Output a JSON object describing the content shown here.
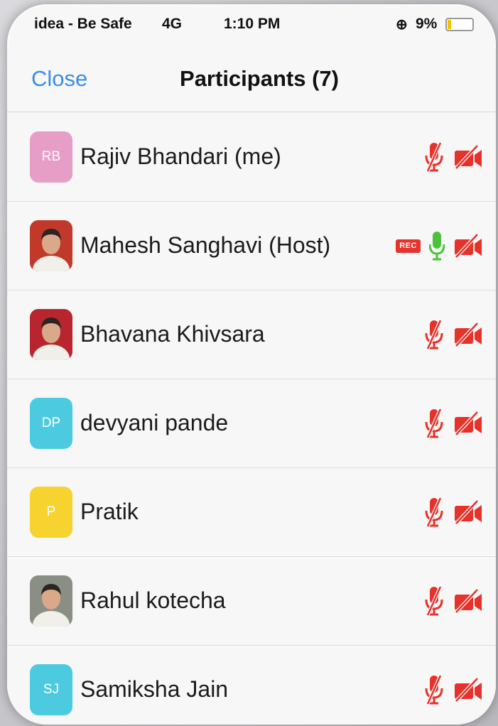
{
  "status_bar": {
    "carrier": "idea - Be Safe",
    "network": "4G",
    "time": "1:10 PM",
    "battery": "9%"
  },
  "header": {
    "close_label": "Close",
    "title": "Participants (7)"
  },
  "colors": {
    "accent": "#3a8ee6",
    "muted_red": "#e5322a",
    "mic_on_green": "#4cc23c"
  },
  "participants": [
    {
      "name": "Rajiv Bhandari (me)",
      "initials": "RB",
      "avatar_color": "#e69ec6",
      "avatar_type": "initials",
      "rec": false,
      "mic": "muted",
      "video": "off"
    },
    {
      "name": "Mahesh Sanghavi (Host)",
      "initials": "",
      "avatar_color": "#c0392b",
      "avatar_type": "photo",
      "rec": true,
      "rec_label": "REC",
      "mic": "on",
      "video": "off"
    },
    {
      "name": "Bhavana Khivsara",
      "initials": "",
      "avatar_color": "#b8252f",
      "avatar_type": "photo",
      "rec": false,
      "mic": "muted",
      "video": "off"
    },
    {
      "name": "devyani pande",
      "initials": "DP",
      "avatar_color": "#4ccbe0",
      "avatar_type": "initials",
      "rec": false,
      "mic": "muted",
      "video": "off"
    },
    {
      "name": "Pratik",
      "initials": "P",
      "avatar_color": "#f7d330",
      "avatar_type": "initials",
      "rec": false,
      "mic": "muted",
      "video": "off"
    },
    {
      "name": "Rahul kotecha",
      "initials": "",
      "avatar_color": "#8a8f85",
      "avatar_type": "photo",
      "rec": false,
      "mic": "muted",
      "video": "off"
    },
    {
      "name": "Samiksha Jain",
      "initials": "SJ",
      "avatar_color": "#4ccbe0",
      "avatar_type": "initials",
      "rec": false,
      "mic": "muted",
      "video": "off"
    }
  ]
}
